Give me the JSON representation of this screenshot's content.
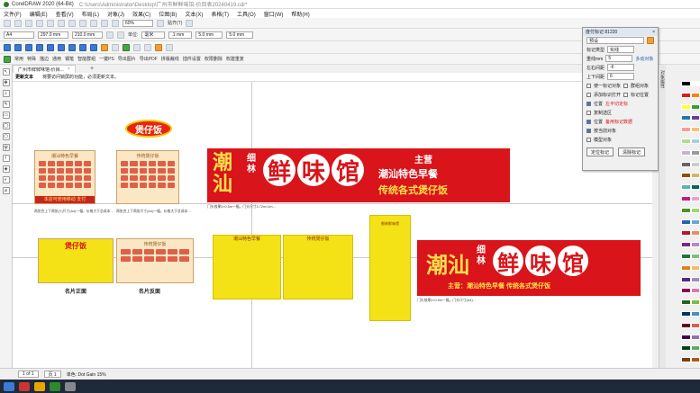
{
  "window": {
    "title": "CorelDRAW 2020 (64-Bit)",
    "path": "C:\\Users\\Administrator\\Desktop\\广州市鲜鲜味馆-价目表20240419.cdr*"
  },
  "menu": [
    "文件(F)",
    "编辑(E)",
    "查看(V)",
    "布局(L)",
    "对象(J)",
    "效果(C)",
    "位图(B)",
    "文本(X)",
    "表格(T)",
    "工具(O)",
    "窗口(W)",
    "帮助(H)"
  ],
  "toolbar": {
    "zoom": "60%",
    "snap_label": "贴齐(T)",
    "page_size": "A4",
    "width": "297.0 mm",
    "height": "210.0 mm",
    "units_label": "单位:",
    "units": "毫米",
    "nudge": ".1 mm",
    "dup_x": "5.0 mm",
    "dup_y": "5.0 mm",
    "row3": [
      "常用",
      "特殊",
      "描边",
      "通用",
      "钢笔",
      "智能群组",
      "一键PS",
      "导出图片",
      "导出PDF",
      "拼版裁线",
      "插件设置",
      "权限删除",
      "权建重复"
    ]
  },
  "document_tab": {
    "label": "广州市鲜鲜味馆-价目...",
    "close": "×",
    "add": "+"
  },
  "hint": {
    "title": "更新文本",
    "message": "将要访问锁屏的功能，必须更新文本。"
  },
  "tools": [
    "↖",
    "✥",
    "⌕",
    "✎",
    "▭",
    "◯",
    "⬡",
    "字",
    "/",
    "◈",
    "◐",
    "⌀"
  ],
  "canvas": {
    "stamp_text": "煲仔饭",
    "menu_left_title": "潮汕特色早餐",
    "menu_left_footer": "本店可使用移动 支付",
    "menu_left_caption": "两张合上下两张(Y)尺寸(A4)一幅，价格大于总成本…",
    "menu_left2_title": "传统煲仔饭",
    "menu_left2_caption": "两张合上下两张尺寸(A4)一幅，价格大于总成本…",
    "banner_top": {
      "left_big": "潮汕",
      "small": "细林",
      "circles": [
        "鲜",
        "味",
        "馆"
      ],
      "tag": "主营",
      "line1": "潮汕特色早餐",
      "line2": "传统各式煲仔饭",
      "caption": "门头效果2×0.5m一幅，门头尺寸3.72m×1m…"
    },
    "card_front_label": "名片正面",
    "card_back_label": "名片反面",
    "card_front_title": "煲仔饭",
    "card_back_title": "传统煲仔饭",
    "sheet1_title": "潮汕特色早餐",
    "sheet2_title": "传统煲仔饭",
    "tall_title": "细林鲜味馆",
    "tall_caption": "…",
    "banner_bottom": {
      "left_big": "潮汕",
      "small": "细林",
      "circles": [
        "鲜",
        "味",
        "馆"
      ],
      "line": "主营：潮汕特色早餐    传统各式煲仔饭",
      "caption": "门头效果2×0.5m一幅，门头尺寸(A4)…"
    }
  },
  "docker": {
    "title": "度付标记 81220",
    "preset": "预设",
    "fields": [
      {
        "label": "标记类型",
        "value": "实线"
      },
      {
        "label": "重线mm",
        "value": "5",
        "btn": "多动对象"
      },
      {
        "label": "左右间距",
        "value": "-6"
      },
      {
        "label": "上下间距",
        "value": "6"
      }
    ],
    "checks": [
      {
        "label": "使一标记对象",
        "on": false
      },
      {
        "label": "群组对象",
        "on": false
      },
      {
        "label": "添加标识打开",
        "on": false
      },
      {
        "label": "标记位置",
        "on": false
      },
      {
        "label": "位置",
        "on": true
      },
      {
        "label": "复制选区",
        "on": false
      },
      {
        "label": "位置",
        "on": true
      },
      {
        "label": "按当前对象",
        "on": true
      },
      {
        "label": "模型对象",
        "on": false
      }
    ],
    "red_notes": [
      "左平切定标",
      "备用标记数据"
    ],
    "buttons": [
      "定位标记",
      "清除标记"
    ]
  },
  "right_dock_label": "对象属性",
  "status": {
    "pages": [
      "1 of 1",
      "页 1"
    ],
    "text": "单色: Dot Gain 15%"
  },
  "palette": [
    "#000000",
    "#ffffff",
    "#e31a1c",
    "#ff7f00",
    "#ffff33",
    "#33a02c",
    "#1f78b4",
    "#6a3d9a",
    "#fb9a99",
    "#fdbf6f",
    "#b2df8a",
    "#a6cee3",
    "#cab2d6",
    "#999999",
    "#666666",
    "#cccccc",
    "#8c510a",
    "#d8b365",
    "#5ab4ac",
    "#01665e",
    "#c51b7d",
    "#e9a3c9",
    "#4d9221",
    "#a1d76a",
    "#2166ac",
    "#67a9cf",
    "#b2182b",
    "#ef8a62",
    "#762a83",
    "#af8dc3",
    "#1b7837",
    "#7fbf7b",
    "#e08214",
    "#fdb863",
    "#542788",
    "#998ec3",
    "#8e0152",
    "#de77ae",
    "#276419",
    "#7fbc41",
    "#053061",
    "#4393c3",
    "#67001f",
    "#d6604d",
    "#40004b",
    "#9970ab",
    "#00441b",
    "#5aae61",
    "#7f3b08",
    "#b35806"
  ]
}
